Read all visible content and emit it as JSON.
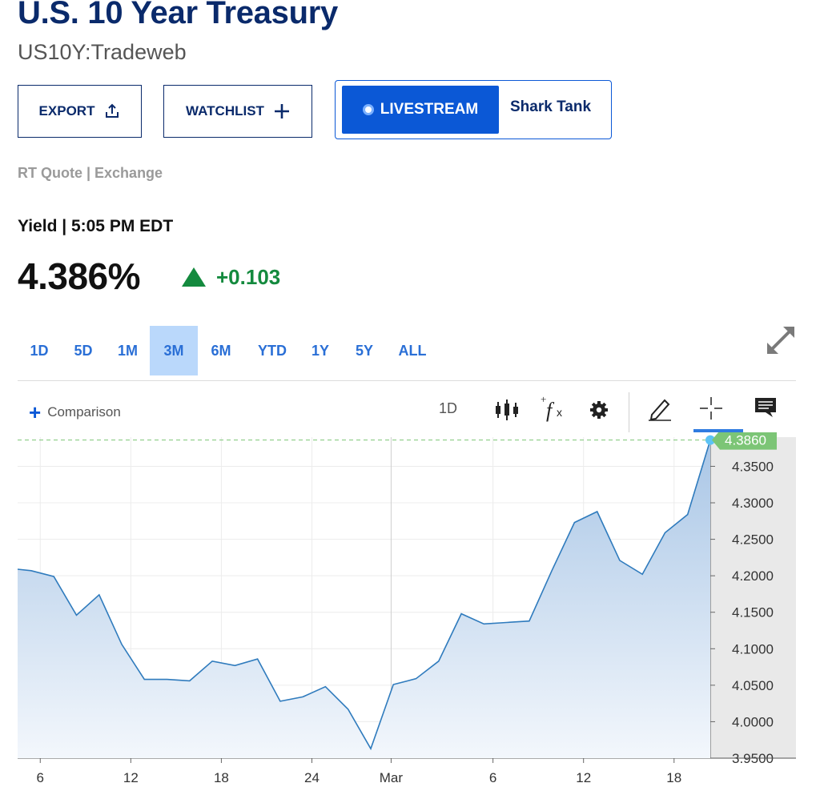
{
  "header": {
    "title": "U.S. 10 Year Treasury",
    "symbol": "US10Y:Tradeweb"
  },
  "actions": {
    "export_label": "EXPORT",
    "watchlist_label": "WATCHLIST",
    "livestream_label": "LIVESTREAM",
    "show_label": "Shark Tank"
  },
  "quote": {
    "source": "RT Quote | Exchange",
    "yield_label": "Yield | 5:05 PM EDT",
    "price": "4.386%",
    "change": "+0.103",
    "direction": "up",
    "color_up": "#148a3e"
  },
  "ranges": [
    "1D",
    "5D",
    "1M",
    "3M",
    "6M",
    "YTD",
    "1Y",
    "5Y",
    "ALL"
  ],
  "active_range": "3M",
  "toolbar": {
    "comparison_label": "Comparison",
    "period_label": "1D",
    "icons": [
      "candlestick-icon",
      "function-icon",
      "gear-icon",
      "pencil-icon",
      "crosshair-icon",
      "comment-icon"
    ]
  },
  "colors": {
    "brand": "#0a2a6b",
    "accent": "#0b58d6",
    "line": "#2f7bbd",
    "last_price": "#7cc576"
  },
  "chart_data": {
    "type": "area",
    "ylim": [
      3.95,
      4.39
    ],
    "x_ticks": [
      {
        "label": "6",
        "x": 1
      },
      {
        "label": "12",
        "x": 5
      },
      {
        "label": "18",
        "x": 9
      },
      {
        "label": "24",
        "x": 13
      },
      {
        "label": "Mar",
        "x": 16.5
      },
      {
        "label": "6",
        "x": 21
      },
      {
        "label": "12",
        "x": 25
      },
      {
        "label": "18",
        "x": 29
      }
    ],
    "y_ticks": [
      "4.3500",
      "4.3000",
      "4.2500",
      "4.2000",
      "4.1500",
      "4.1000",
      "4.0500",
      "4.0000",
      "3.9500"
    ],
    "last_value_label": "4.3860",
    "grid": true,
    "series": [
      {
        "x": [
          0,
          0.6,
          1.6,
          2.6,
          3.6,
          4.6,
          5.6,
          6.6,
          7.6,
          8.6,
          9.6,
          10.6,
          11.6,
          12.6,
          13.6,
          14.6,
          15.6,
          16.6,
          17.6,
          18.6,
          19.6,
          20.6,
          21.6,
          22.6,
          23.6,
          24.6,
          25.6,
          26.6,
          27.6,
          28.6,
          29.6,
          30.6
        ],
        "values": [
          4.209,
          4.207,
          4.199,
          4.146,
          4.174,
          4.106,
          4.058,
          4.058,
          4.056,
          4.083,
          4.077,
          4.086,
          4.028,
          4.034,
          4.048,
          4.017,
          3.963,
          4.051,
          4.059,
          4.083,
          4.148,
          4.134,
          4.136,
          4.138,
          4.207,
          4.273,
          4.288,
          4.221,
          4.202,
          4.259,
          4.284,
          4.386
        ]
      }
    ]
  }
}
